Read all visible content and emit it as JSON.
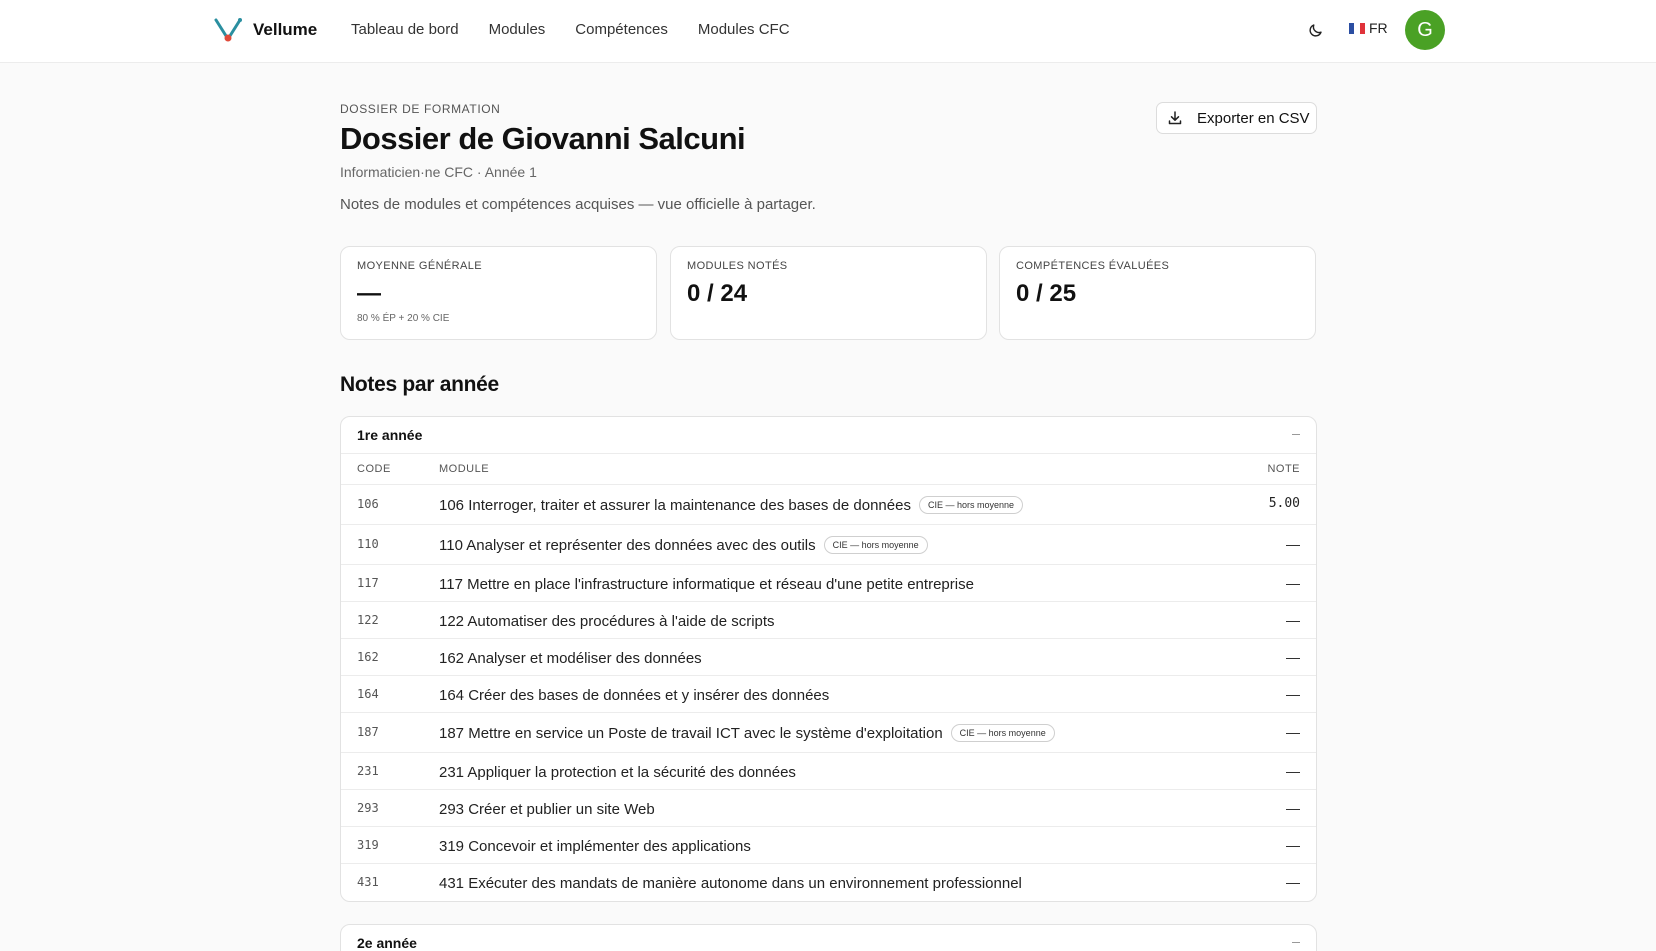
{
  "app": {
    "name": "Vellume"
  },
  "nav": [
    "Tableau de bord",
    "Modules",
    "Compétences",
    "Modules CFC"
  ],
  "header": {
    "lang": "FR",
    "avatar_initial": "G"
  },
  "page": {
    "eyebrow": "DOSSIER DE FORMATION",
    "title": "Dossier de Giovanni Salcuni",
    "subtitle": "Informaticien·ne CFC · Année 1",
    "description": "Notes de modules et compétences acquises — vue officielle à partager.",
    "export_label": "Exporter en CSV"
  },
  "stats": [
    {
      "label": "MOYENNE GÉNÉRALE",
      "value": "—",
      "note": "80 % ÉP + 20 % CIE"
    },
    {
      "label": "MODULES NOTÉS",
      "value": "0 / 24",
      "note": ""
    },
    {
      "label": "COMPÉTENCES ÉVALUÉES",
      "value": "0 / 25",
      "note": ""
    }
  ],
  "section_title": "Notes par année",
  "columns": {
    "code": "CODE",
    "module": "MODULE",
    "note": "NOTE"
  },
  "years": [
    {
      "title": "1re année",
      "rows": [
        {
          "code": "106",
          "module": "106 Interroger, traiter et assurer la maintenance des bases de données",
          "badge": "CIE — hors moyenne",
          "note": "5.00"
        },
        {
          "code": "110",
          "module": "110 Analyser et représenter des données avec des outils",
          "badge": "CIE — hors moyenne",
          "note": "—"
        },
        {
          "code": "117",
          "module": "117 Mettre en place l'infrastructure informatique et réseau d'une petite entreprise",
          "badge": "",
          "note": "—"
        },
        {
          "code": "122",
          "module": "122 Automatiser des procédures à l'aide de scripts",
          "badge": "",
          "note": "—"
        },
        {
          "code": "162",
          "module": "162 Analyser et modéliser des données",
          "badge": "",
          "note": "—"
        },
        {
          "code": "164",
          "module": "164 Créer des bases de données et y insérer des données",
          "badge": "",
          "note": "—"
        },
        {
          "code": "187",
          "module": "187 Mettre en service un Poste de travail ICT avec le système d'exploitation",
          "badge": "CIE — hors moyenne",
          "note": "—"
        },
        {
          "code": "231",
          "module": "231 Appliquer la protection et la sécurité des données",
          "badge": "",
          "note": "—"
        },
        {
          "code": "293",
          "module": "293 Créer et publier un site Web",
          "badge": "",
          "note": "—"
        },
        {
          "code": "319",
          "module": "319 Concevoir et implémenter des applications",
          "badge": "",
          "note": "—"
        },
        {
          "code": "431",
          "module": "431 Exécuter des mandats de manière autonome dans un environnement professionnel",
          "badge": "",
          "note": "—"
        }
      ]
    },
    {
      "title": "2e année",
      "rows": []
    }
  ],
  "colors": {
    "accent": "#4aa125",
    "logo_teal": "#2a8fa0",
    "logo_red": "#e04a3a"
  }
}
